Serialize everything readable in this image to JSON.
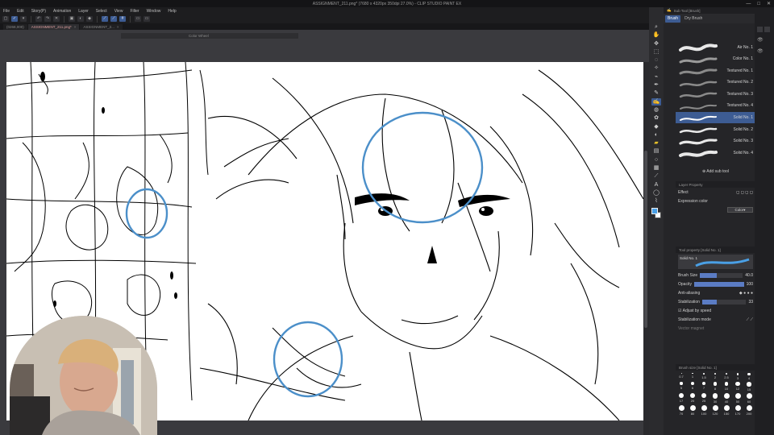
{
  "window": {
    "title": "ASSIGNMENT_211.png* (7680 x 4320px 350dpi 27.0%) - CLIP STUDIO PAINT EX",
    "buttons": [
      "—",
      "□",
      "✕"
    ]
  },
  "menu": [
    "File",
    "Edit",
    "Story(P)",
    "Animation",
    "Layer",
    "Select",
    "View",
    "Filter",
    "Window",
    "Help"
  ],
  "command_bar": {
    "icons": [
      "new-icon",
      "open-icon",
      "save-icon",
      "undo-icon",
      "redo-icon",
      "clear-icon",
      "transform-icon",
      "rotate-icon",
      "snap-icon",
      "ruler-icon",
      "grid-icon"
    ]
  },
  "tabs": [
    {
      "label": "(0268,000)",
      "active": false
    },
    {
      "label": "ASSIGNMENT_211.png*",
      "active": true
    },
    {
      "label": "ASSIGNMENT_2...",
      "active": false
    }
  ],
  "navigator": {
    "label": "Color Wheel"
  },
  "sub_tool": {
    "header": "Sub Tool [Brush]",
    "tabs": [
      "Brush",
      "Dry Brush"
    ],
    "brushes": [
      {
        "label": "Air No. 1",
        "selected": false
      },
      {
        "label": "Color No. 1",
        "selected": false
      },
      {
        "label": "Textured No. 1",
        "selected": false
      },
      {
        "label": "Textured No. 2",
        "selected": false
      },
      {
        "label": "Textured No. 3",
        "selected": false
      },
      {
        "label": "Textured No. 4",
        "selected": false
      },
      {
        "label": "Solid No. 1",
        "selected": true
      },
      {
        "label": "Solid No. 2",
        "selected": false
      },
      {
        "label": "Solid No. 3",
        "selected": false
      },
      {
        "label": "Solid No. 4",
        "selected": false
      }
    ],
    "add_label": "Add sub tool"
  },
  "layer_property": {
    "header": "Layer Property",
    "effect_label": "Effect",
    "expression_label": "Expression color",
    "expression_value": "Color"
  },
  "tool_property": {
    "header": "Tool property [Solid No. 1]",
    "preview_label": "Solid No. 1",
    "brush_size_label": "Brush Size",
    "brush_size_value": "40.0",
    "opacity_label": "Opacity",
    "opacity_value": "100",
    "opacity_fraction": 1.0,
    "brush_size_fraction": 0.4,
    "anti_alias_label": "Anti-aliasing",
    "stabilization_label": "Stabilization",
    "stabilization_value": "33",
    "stabilization_fraction": 0.33,
    "adjust_label": "Adjust by speed",
    "stab_mode_label": "Stabilization mode",
    "vector_label": "Vector magnet"
  },
  "brush_size": {
    "header": "Brush size [Solid No. 1]",
    "values": [
      "0.7",
      "1",
      "1.5",
      "2",
      "2.5",
      "3",
      "4",
      "5",
      "6",
      "7",
      "8",
      "10",
      "12",
      "15",
      "17",
      "20",
      "25",
      "30",
      "40",
      "50",
      "60",
      "70",
      "80",
      "100",
      "120",
      "150",
      "170",
      "200"
    ]
  },
  "tools": [
    "zoom-icon",
    "hand-icon",
    "move-icon",
    "select-icon",
    "lasso-icon",
    "auto-select-icon",
    "eyedropper-icon",
    "pen-icon",
    "pencil-icon",
    "brush-icon",
    "airbrush-icon",
    "decoration-icon",
    "eraser-icon",
    "blend-icon",
    "fill-icon",
    "gradient-icon",
    "figure-icon",
    "frame-icon",
    "ruler-tool-icon",
    "text-icon",
    "balloon-icon",
    "correct-line-icon"
  ],
  "colors": {
    "accent": "#3d5c93",
    "annotation": "#4b8fc9",
    "main_color": "#4aa0e6"
  }
}
